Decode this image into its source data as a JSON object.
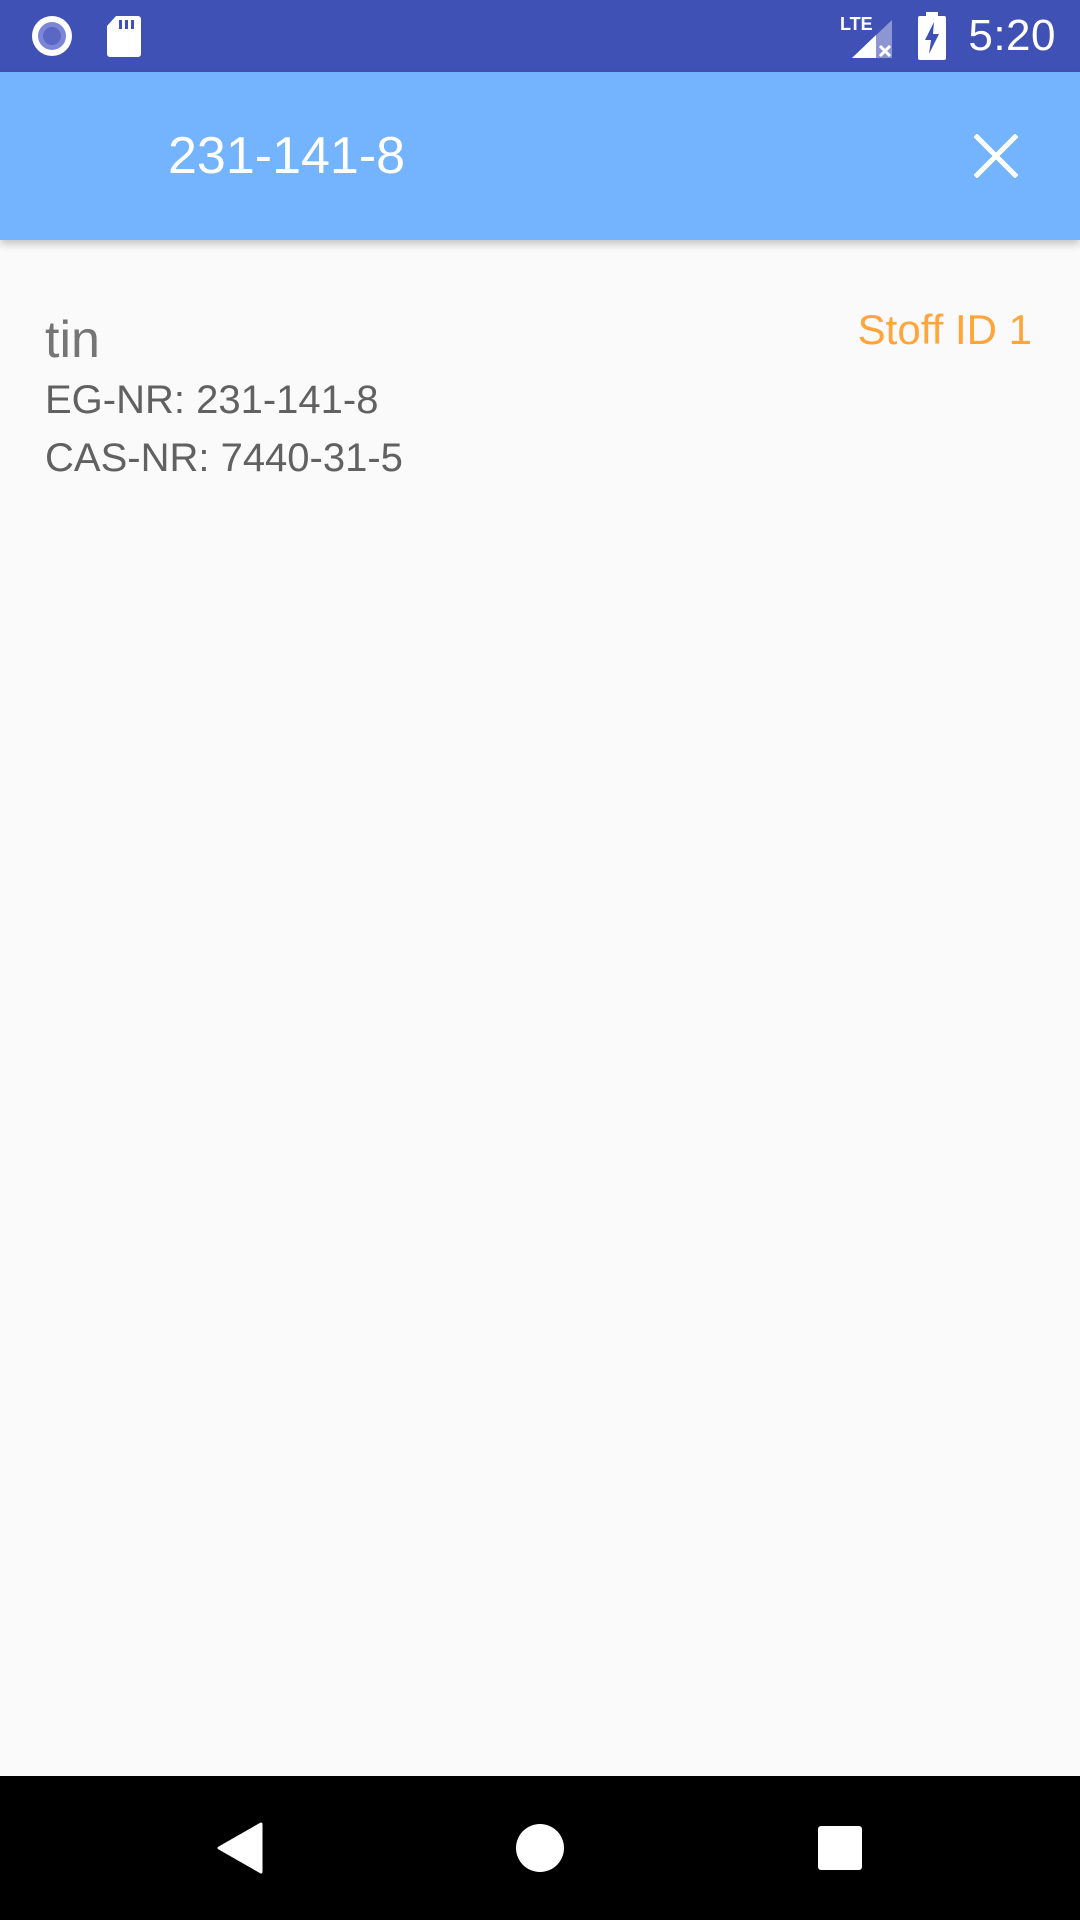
{
  "status_bar": {
    "time": "5:20",
    "network_label": "LTE",
    "icons": [
      "record-icon",
      "sd-card-icon",
      "signal-lte-icon",
      "battery-charging-icon"
    ]
  },
  "app_bar": {
    "title": "231-141-8",
    "close_icon": "close-icon"
  },
  "results": [
    {
      "name": "tin",
      "eg_nr": "EG-NR: 231-141-8",
      "cas_nr": "CAS-NR: 7440-31-5",
      "stoff_id": "Stoff ID 1"
    }
  ],
  "nav_bar": {
    "icons": [
      "back-icon",
      "home-icon",
      "recents-icon"
    ]
  },
  "colors": {
    "status_bar": "#3f51b5",
    "app_bar": "#74b3fe",
    "accent": "#ffa53a",
    "background": "#fafafa"
  }
}
